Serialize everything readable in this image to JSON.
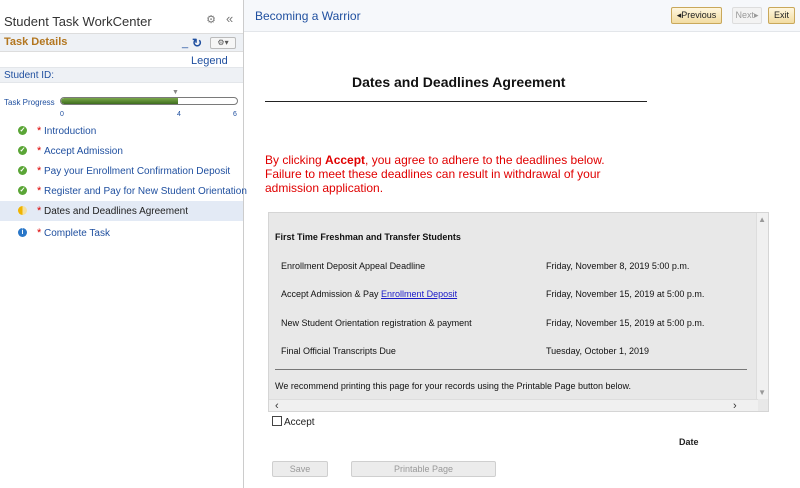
{
  "sidebar": {
    "title": "Student Task WorkCenter",
    "gear_glyph": "⚙",
    "collapse_glyph": "«",
    "task_details_title": "Task Details",
    "refresh_glyph": "↻",
    "actions_glyph": "⚙▾",
    "legend_link": "Legend",
    "student_id_label": "Student ID:",
    "task_progress": {
      "label": "Task Progress",
      "value": 4,
      "max": 6,
      "fraction": 0.667,
      "ticks": [
        "0",
        "4",
        "6"
      ],
      "marker_glyph": "▼"
    },
    "steps": [
      {
        "label": "Introduction",
        "status": "complete",
        "icon": "check-icon",
        "required_mark": "*"
      },
      {
        "label": "Accept Admission",
        "status": "complete",
        "icon": "check-icon",
        "required_mark": "*"
      },
      {
        "label": "Pay your Enrollment Confirmation Deposit",
        "status": "complete",
        "icon": "check-icon",
        "required_mark": "*"
      },
      {
        "label": "Register and Pay for New Student Orientation",
        "status": "complete",
        "icon": "check-icon",
        "required_mark": "*"
      },
      {
        "label": "Dates and Deadlines Agreement",
        "status": "in-progress",
        "icon": "half-circle-icon",
        "required_mark": "*"
      },
      {
        "label": "Complete Task",
        "status": "info",
        "icon": "info-icon",
        "required_mark": "*"
      }
    ]
  },
  "header": {
    "title": "Becoming a Warrior",
    "prev_label": "◂Previous",
    "next_label": "Next▸",
    "exit_label": "Exit"
  },
  "main": {
    "agreement_title": "Dates and Deadlines Agreement",
    "warning": {
      "prefix": "By clicking ",
      "bold": "Accept",
      "suffix": ", you agree to adhere to the deadlines below. Failure to meet these deadlines can result in withdrawal of your admission application."
    },
    "deadlines": {
      "header": "First Time Freshman and Transfer Students",
      "rows": [
        {
          "name": "Enrollment Deposit Appeal Deadline",
          "link": "",
          "date": "Friday, November 8, 2019 5:00 p.m."
        },
        {
          "name": "Accept Admission & Pay ",
          "link": "Enrollment Deposit",
          "date": "Friday, November 15, 2019 at 5:00 p.m."
        },
        {
          "name": "New Student Orientation registration & payment",
          "link": "",
          "date": "Friday, November 15, 2019 at 5:00 p.m."
        },
        {
          "name": "Final Official Transcripts Due",
          "link": "",
          "date": "Tuesday, October 1, 2019"
        }
      ],
      "note": "We recommend printing this page for your records using the Printable Page button below."
    },
    "accept_label": "Accept",
    "date_label": "Date",
    "save_label": "Save",
    "print_label": "Printable Page"
  },
  "colors": {
    "link": "#1f4f9f",
    "warning": "#e00000",
    "task_details_header": "#b3761f",
    "progress_fill": "#4f7f2a",
    "complete_icon": "#5aa536",
    "current_step_bg": "#e3eaf5"
  }
}
